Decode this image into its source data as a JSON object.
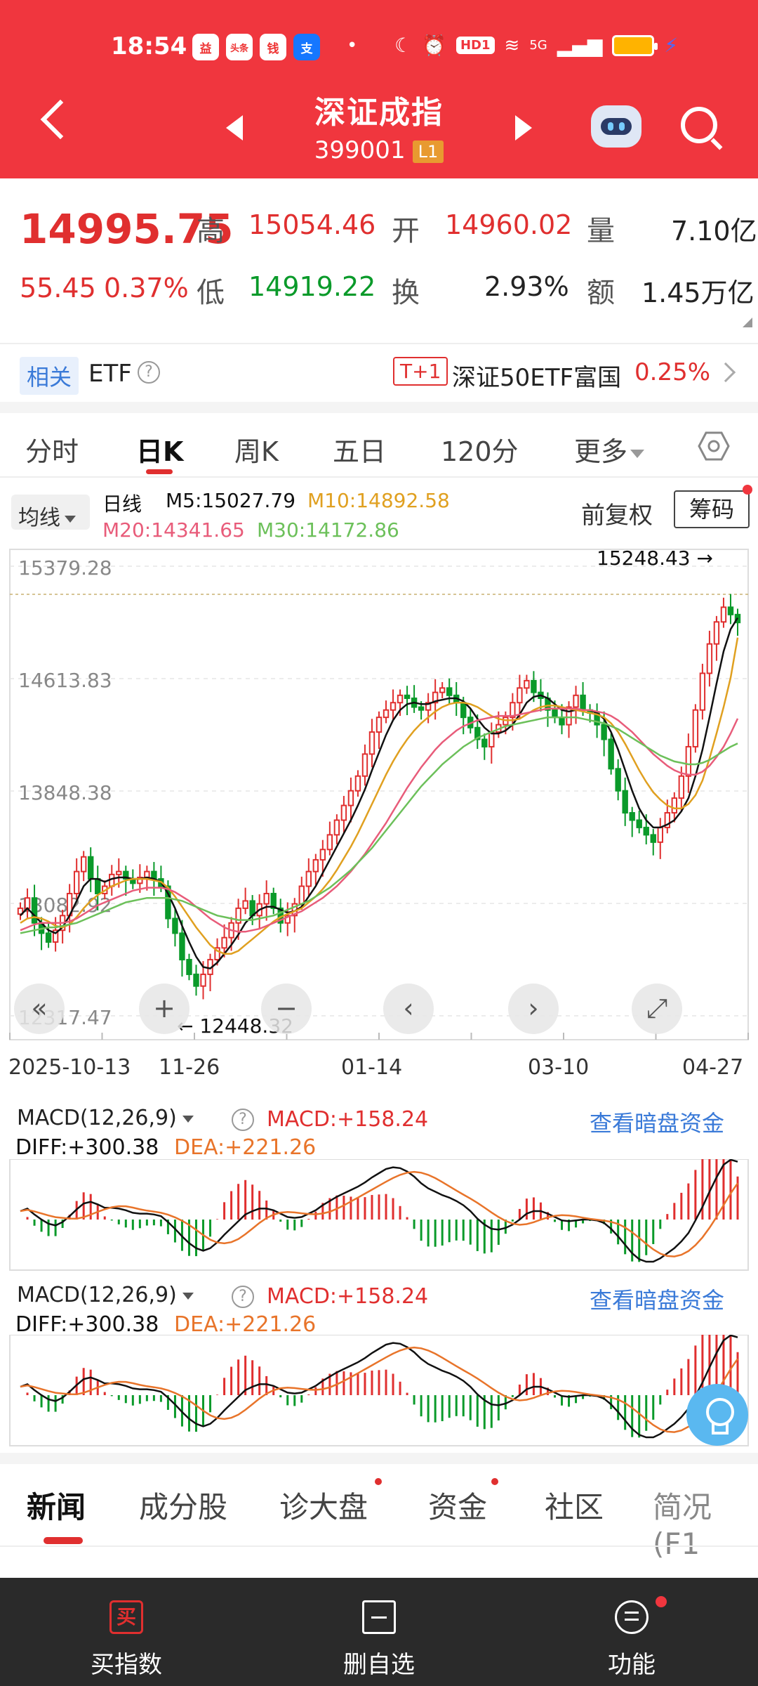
{
  "status": {
    "time": "18:54",
    "app_badges": [
      "益",
      "头条",
      "钱",
      "支"
    ],
    "hd": "HD1",
    "net": "5G"
  },
  "header": {
    "title": "深证成指",
    "code": "399001",
    "level": "L1"
  },
  "quote": {
    "price": "14995.75",
    "change": "55.45",
    "change_pct": "0.37%",
    "high_label": "高",
    "high": "15054.46",
    "low_label": "低",
    "low": "14919.22",
    "open_label": "开",
    "open": "14960.02",
    "turnover_label": "换",
    "turnover": "2.93%",
    "volume_label": "量",
    "volume": "7.10亿",
    "amount_label": "额",
    "amount": "1.45万亿"
  },
  "etf": {
    "tag": "相关",
    "label": "ETF",
    "help": "?",
    "t1": "T+1",
    "name": "深证50ETF富国",
    "pct": "0.25%"
  },
  "tabs": [
    {
      "label": "分时"
    },
    {
      "label": "日K"
    },
    {
      "label": "周K"
    },
    {
      "label": "五日"
    },
    {
      "label": "120分"
    },
    {
      "label": "更多"
    }
  ],
  "ma_bar": {
    "button": "均线",
    "period": "日线",
    "m5": "M5:15027.79",
    "m10": "M10:14892.58",
    "m20": "M20:14341.65",
    "m30": "M30:14172.86",
    "adjust": "前复权",
    "chips": "筹码"
  },
  "chart_data": {
    "type": "candlestick",
    "y_ticks": [
      "15379.28",
      "14613.83",
      "13848.38",
      "13082.92",
      "12317.47"
    ],
    "ylim": [
      12317.47,
      15379.28
    ],
    "max_label": "15248.43",
    "min_label": "12448.32",
    "dates": [
      "2025-10-13",
      "11-26",
      "01-14",
      "03-10",
      "04-27"
    ],
    "controls": [
      "«",
      "+",
      "−",
      "‹",
      "›",
      "⤢"
    ],
    "closes": [
      13050,
      13120,
      12950,
      12880,
      12820,
      12900,
      13000,
      13150,
      13300,
      13400,
      13250,
      13150,
      13200,
      13280,
      13300,
      13250,
      13220,
      13260,
      13300,
      13250,
      13200,
      12980,
      12880,
      12700,
      12600,
      12520,
      12600,
      12700,
      12780,
      12850,
      12950,
      13050,
      13100,
      13000,
      13080,
      13150,
      13050,
      12950,
      13000,
      13080,
      13200,
      13300,
      13380,
      13450,
      13550,
      13650,
      13750,
      13850,
      13950,
      14100,
      14250,
      14350,
      14400,
      14450,
      14500,
      14480,
      14420,
      14400,
      14450,
      14520,
      14550,
      14500,
      14450,
      14350,
      14280,
      14200,
      14150,
      14250,
      14300,
      14350,
      14450,
      14550,
      14600,
      14520,
      14480,
      14400,
      14350,
      14300,
      14420,
      14500,
      14400,
      14380,
      14300,
      14200,
      14000,
      13850,
      13700,
      13650,
      13600,
      13550,
      13500,
      13600,
      13700,
      13800,
      13950,
      14150,
      14400,
      14650,
      14850,
      15000,
      15100,
      15050,
      14995.75
    ],
    "ma5": [
      13000,
      13050,
      13000,
      12950,
      12900,
      12880,
      12920,
      13000,
      13100,
      13200,
      13250,
      13250,
      13230,
      13250,
      13260,
      13260,
      13250,
      13250,
      13260,
      13250,
      13230,
      13150,
      13050,
      12930,
      12820,
      12720,
      12650,
      12640,
      12680,
      12740,
      12800,
      12870,
      12950,
      13000,
      13040,
      13060,
      13060,
      13040,
      13020,
      13030,
      13060,
      13130,
      13200,
      13290,
      13380,
      13470,
      13560,
      13650,
      13750,
      13860,
      13990,
      14110,
      14230,
      14330,
      14400,
      14440,
      14450,
      14440,
      14440,
      14460,
      14470,
      14480,
      14480,
      14460,
      14410,
      14340,
      14280,
      14240,
      14240,
      14260,
      14300,
      14370,
      14450,
      14490,
      14500,
      14480,
      14440,
      14400,
      14390,
      14400,
      14400,
      14400,
      14380,
      14340,
      14250,
      14130,
      13990,
      13850,
      13730,
      13650,
      13600,
      13600,
      13620,
      13650,
      13710,
      13800,
      13950,
      14130,
      14350,
      14580,
      14800,
      14950,
      15027.79
    ],
    "ma10": [
      12950,
      12980,
      12990,
      12980,
      12960,
      12930,
      12920,
      12940,
      12990,
      13050,
      13100,
      13140,
      13170,
      13200,
      13220,
      13240,
      13250,
      13250,
      13250,
      13240,
      13230,
      13190,
      13130,
      13060,
      12990,
      12920,
      12860,
      12800,
      12760,
      12740,
      12740,
      12760,
      12800,
      12840,
      12880,
      12920,
      12960,
      12990,
      13010,
      13030,
      13050,
      13090,
      13130,
      13180,
      13240,
      13310,
      13390,
      13470,
      13560,
      13660,
      13760,
      13860,
      13960,
      14050,
      14130,
      14200,
      14260,
      14310,
      14350,
      14390,
      14420,
      14440,
      14450,
      14450,
      14440,
      14420,
      14390,
      14360,
      14340,
      14330,
      14330,
      14340,
      14370,
      14400,
      14420,
      14430,
      14430,
      14420,
      14410,
      14400,
      14390,
      14380,
      14370,
      14350,
      14310,
      14250,
      14170,
      14080,
      13990,
      13910,
      13840,
      13790,
      13750,
      13730,
      13730,
      13760,
      13820,
      13920,
      14070,
      14240,
      14420,
      14620,
      14892.58
    ],
    "ma20": [
      12900,
      12920,
      12940,
      12950,
      12950,
      12950,
      12950,
      12960,
      12980,
      13010,
      13040,
      13070,
      13090,
      13110,
      13130,
      13150,
      13170,
      13180,
      13190,
      13190,
      13190,
      13180,
      13160,
      13130,
      13100,
      13060,
      13020,
      12980,
      12950,
      12920,
      12900,
      12890,
      12890,
      12900,
      12910,
      12930,
      12950,
      12970,
      12990,
      13010,
      13030,
      13060,
      13090,
      13120,
      13160,
      13200,
      13250,
      13300,
      13360,
      13420,
      13490,
      13560,
      13630,
      13710,
      13790,
      13870,
      13940,
      14010,
      14070,
      14130,
      14180,
      14220,
      14260,
      14290,
      14310,
      14330,
      14340,
      14350,
      14360,
      14360,
      14360,
      14370,
      14380,
      14390,
      14400,
      14410,
      14410,
      14410,
      14410,
      14410,
      14400,
      14400,
      14390,
      14380,
      14360,
      14330,
      14290,
      14250,
      14200,
      14150,
      14100,
      14060,
      14020,
      13990,
      13970,
      13960,
      13960,
      13980,
      14020,
      14080,
      14150,
      14240,
      14341.65
    ],
    "ma30": [
      12880,
      12890,
      12900,
      12910,
      12920,
      12920,
      12930,
      12940,
      12950,
      12970,
      12990,
      13010,
      13030,
      13050,
      13070,
      13090,
      13100,
      13110,
      13120,
      13120,
      13120,
      13120,
      13110,
      13100,
      13080,
      13060,
      13040,
      13020,
      13000,
      12990,
      12980,
      12970,
      12970,
      12970,
      12980,
      12990,
      13000,
      13020,
      13040,
      13060,
      13080,
      13100,
      13130,
      13160,
      13190,
      13230,
      13270,
      13310,
      13360,
      13410,
      13460,
      13520,
      13580,
      13640,
      13700,
      13760,
      13820,
      13880,
      13930,
      13980,
      14030,
      14070,
      14110,
      14150,
      14180,
      14210,
      14230,
      14250,
      14270,
      14290,
      14300,
      14310,
      14320,
      14330,
      14340,
      14350,
      14350,
      14350,
      14350,
      14350,
      14340,
      14330,
      14320,
      14310,
      14290,
      14270,
      14240,
      14210,
      14180,
      14150,
      14120,
      14090,
      14070,
      14050,
      14040,
      14030,
      14030,
      14040,
      14060,
      14090,
      14120,
      14150,
      14172.86
    ]
  },
  "macd": {
    "name": "MACD(12,26,9)",
    "help": "?",
    "macd": "MACD:+158.24",
    "diff": "DIFF:+300.38",
    "dea": "DEA:+221.26",
    "link": "查看暗盘资金"
  },
  "bottom_tabs": [
    {
      "label": "新闻"
    },
    {
      "label": "成分股"
    },
    {
      "label": "诊大盘"
    },
    {
      "label": "资金"
    },
    {
      "label": "社区"
    },
    {
      "label": "简况(F1"
    }
  ],
  "footer": [
    {
      "label": "买指数",
      "icon_text": "买"
    },
    {
      "label": "删自选"
    },
    {
      "label": "功能"
    }
  ],
  "colors": {
    "up": "#e02f2f",
    "down": "#0a9a2a",
    "header": "#f0363e",
    "ma5": "#111111",
    "ma10": "#e0a020",
    "ma20": "#e85c7a",
    "ma30": "#6cc05a"
  }
}
